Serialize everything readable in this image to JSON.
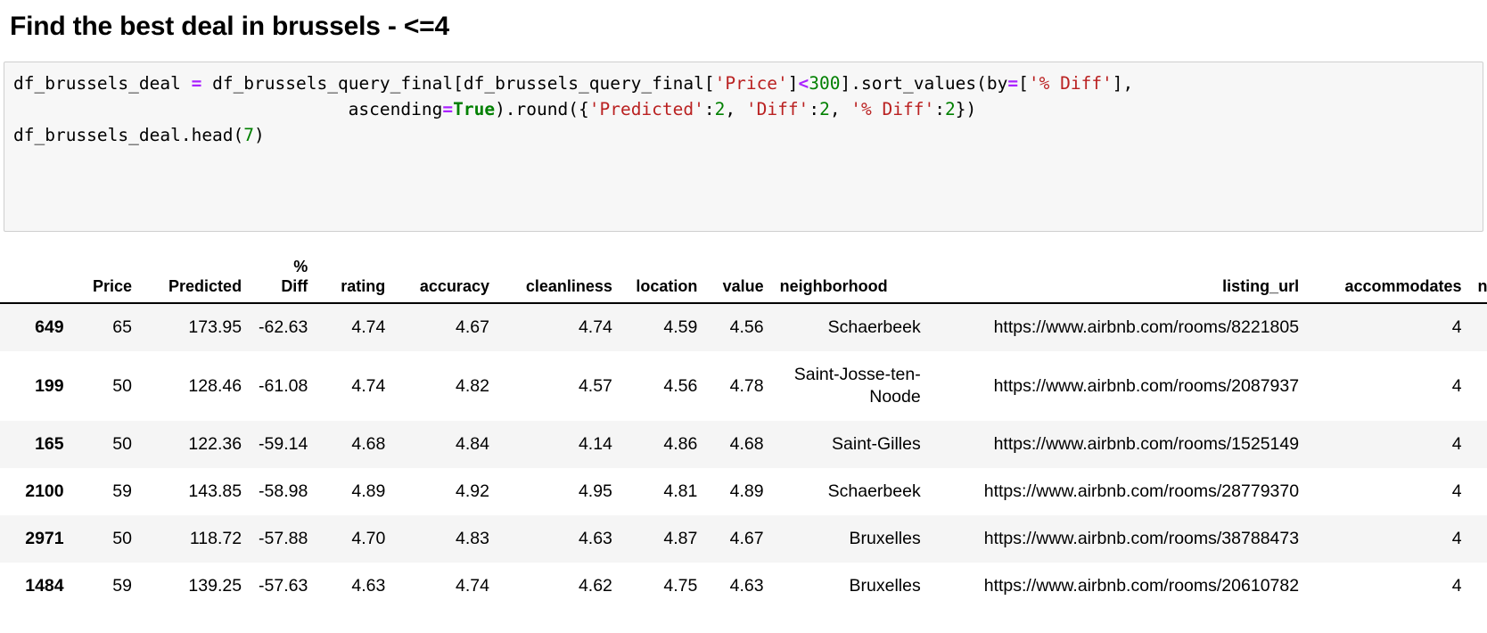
{
  "heading": "Find the best deal in brussels - <=4",
  "code_cell": {
    "line1_a": "df_brussels_deal ",
    "line1_eq": "=",
    "line1_b": " df_brussels_query_final[df_brussels_query_final[",
    "line1_str_price": "'Price'",
    "line1_c": "]",
    "line1_lt": "<",
    "line1_num300": "300",
    "line1_d": "].sort_values(by",
    "line1_eq2": "=",
    "line1_e": "[",
    "line1_str_pctdiff": "'% Diff'",
    "line1_f": "],",
    "line2_indent": "                                ascending",
    "line2_eq": "=",
    "line2_true": "True",
    "line2_a": ").round({",
    "line2_str_predicted": "'Predicted'",
    "line2_b": ":",
    "line2_num2a": "2",
    "line2_c": ", ",
    "line2_str_diff": "'Diff'",
    "line2_d": ":",
    "line2_num2b": "2",
    "line2_e": ", ",
    "line2_str_pctdiff": "'% Diff'",
    "line2_f": ":",
    "line2_num2c": "2",
    "line2_g": "})",
    "line3_a": "df_brussels_deal.head(",
    "line3_num7": "7",
    "line3_b": ")"
  },
  "colors": {
    "operator": "#aa22ff",
    "string": "#ba2121",
    "number": "#008000",
    "keyword": "#008000",
    "code_bg": "#f7f7f7",
    "code_border": "#cfcfcf",
    "row_stripe": "#f5f5f5",
    "text": "#000000"
  },
  "dataframe": {
    "columns": [
      {
        "key": "index",
        "label": ""
      },
      {
        "key": "price",
        "label": "Price"
      },
      {
        "key": "predicted",
        "label": "Predicted"
      },
      {
        "key": "pct_diff",
        "label": "%\nDiff"
      },
      {
        "key": "rating",
        "label": "rating"
      },
      {
        "key": "accuracy",
        "label": "accuracy"
      },
      {
        "key": "cleanliness",
        "label": "cleanliness"
      },
      {
        "key": "location",
        "label": "location"
      },
      {
        "key": "value",
        "label": "value"
      },
      {
        "key": "neighborhood",
        "label": "neighborhood"
      },
      {
        "key": "listing_url",
        "label": "listing_url"
      },
      {
        "key": "accommodates",
        "label": "accommodates"
      },
      {
        "key": "clipped",
        "label": "n"
      }
    ],
    "rows": [
      {
        "index": "649",
        "price": "65",
        "predicted": "173.95",
        "pct_diff": "-62.63",
        "rating": "4.74",
        "accuracy": "4.67",
        "cleanliness": "4.74",
        "location": "4.59",
        "value": "4.56",
        "neighborhood": "Schaerbeek",
        "listing_url": "https://www.airbnb.com/rooms/8221805",
        "accommodates": "4",
        "clipped": ""
      },
      {
        "index": "199",
        "price": "50",
        "predicted": "128.46",
        "pct_diff": "-61.08",
        "rating": "4.74",
        "accuracy": "4.82",
        "cleanliness": "4.57",
        "location": "4.56",
        "value": "4.78",
        "neighborhood": "Saint-Josse-ten-Noode",
        "listing_url": "https://www.airbnb.com/rooms/2087937",
        "accommodates": "4",
        "clipped": ""
      },
      {
        "index": "165",
        "price": "50",
        "predicted": "122.36",
        "pct_diff": "-59.14",
        "rating": "4.68",
        "accuracy": "4.84",
        "cleanliness": "4.14",
        "location": "4.86",
        "value": "4.68",
        "neighborhood": "Saint-Gilles",
        "listing_url": "https://www.airbnb.com/rooms/1525149",
        "accommodates": "4",
        "clipped": ""
      },
      {
        "index": "2100",
        "price": "59",
        "predicted": "143.85",
        "pct_diff": "-58.98",
        "rating": "4.89",
        "accuracy": "4.92",
        "cleanliness": "4.95",
        "location": "4.81",
        "value": "4.89",
        "neighborhood": "Schaerbeek",
        "listing_url": "https://www.airbnb.com/rooms/28779370",
        "accommodates": "4",
        "clipped": ""
      },
      {
        "index": "2971",
        "price": "50",
        "predicted": "118.72",
        "pct_diff": "-57.88",
        "rating": "4.70",
        "accuracy": "4.83",
        "cleanliness": "4.63",
        "location": "4.87",
        "value": "4.67",
        "neighborhood": "Bruxelles",
        "listing_url": "https://www.airbnb.com/rooms/38788473",
        "accommodates": "4",
        "clipped": ""
      },
      {
        "index": "1484",
        "price": "59",
        "predicted": "139.25",
        "pct_diff": "-57.63",
        "rating": "4.63",
        "accuracy": "4.74",
        "cleanliness": "4.62",
        "location": "4.75",
        "value": "4.63",
        "neighborhood": "Bruxelles",
        "listing_url": "https://www.airbnb.com/rooms/20610782",
        "accommodates": "4",
        "clipped": ""
      }
    ]
  }
}
